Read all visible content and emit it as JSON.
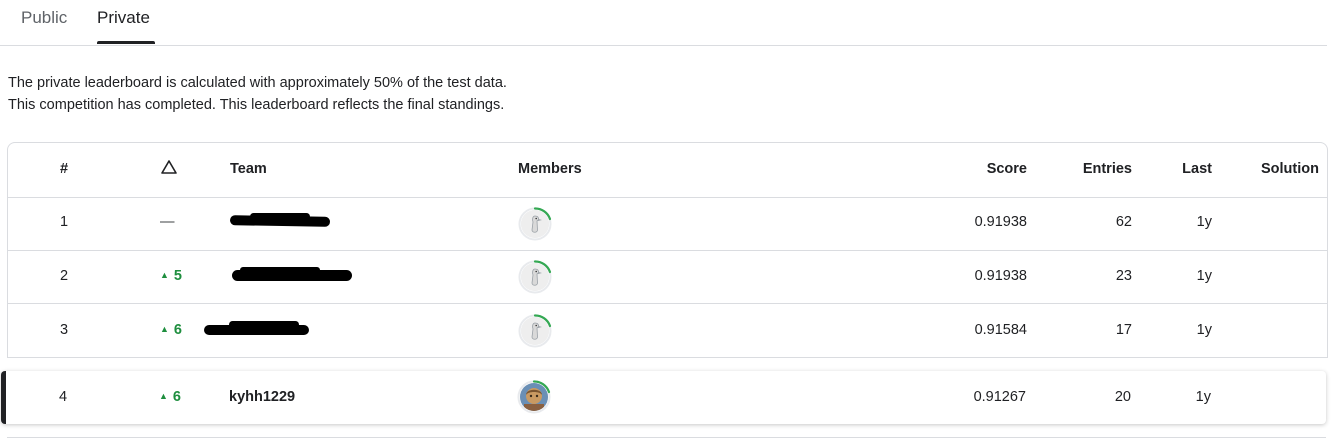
{
  "tabs": [
    {
      "label": "Public",
      "active": false
    },
    {
      "label": "Private",
      "active": true
    }
  ],
  "info": {
    "line1": "The private leaderboard is calculated with approximately 50% of the test data.",
    "line2": "This competition has completed. This leaderboard reflects the final standings."
  },
  "table": {
    "headers": {
      "rank": "#",
      "delta_icon": "triangle-outline-icon",
      "team": "Team",
      "members": "Members",
      "score": "Score",
      "entries": "Entries",
      "last": "Last",
      "solution": "Solution"
    },
    "rows": [
      {
        "rank": "1",
        "delta": "—",
        "team": "",
        "team_redacted": true,
        "score": "0.91938",
        "entries": "62",
        "last": "1y"
      },
      {
        "rank": "2",
        "delta": "5",
        "team": "",
        "team_redacted": true,
        "score": "0.91938",
        "entries": "23",
        "last": "1y"
      },
      {
        "rank": "3",
        "delta": "6",
        "team": "",
        "team_redacted": true,
        "score": "0.91584",
        "entries": "17",
        "last": "1y"
      }
    ],
    "current_user_row": {
      "rank": "4",
      "delta": "6",
      "team": "kyhh1229",
      "score": "0.91267",
      "entries": "20",
      "last": "1y"
    }
  },
  "colors": {
    "up": "#1e8e3e",
    "progress_ring": "#34a853",
    "border": "#dadce0"
  }
}
